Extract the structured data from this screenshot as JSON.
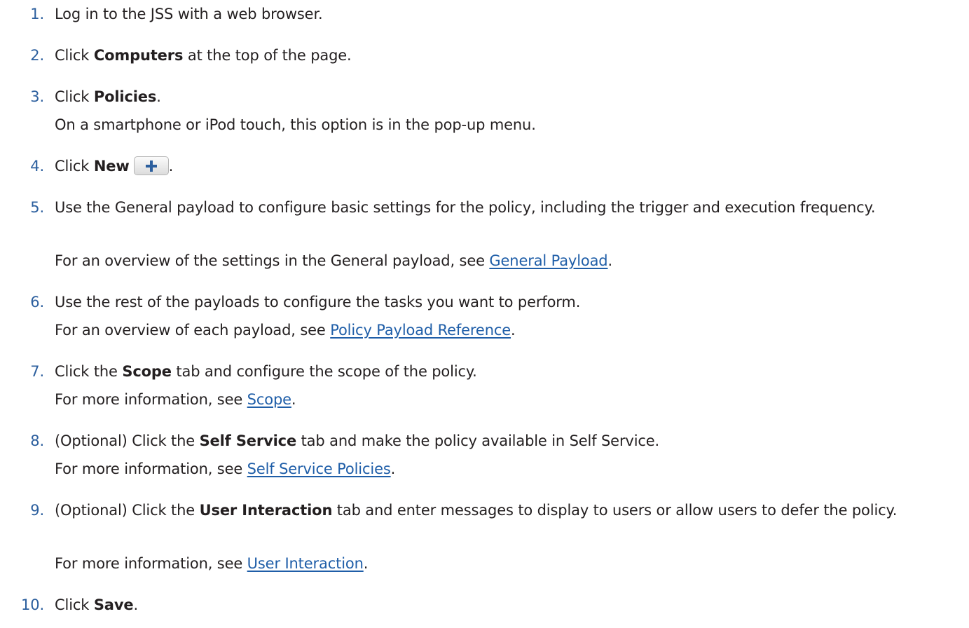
{
  "steps": [
    {
      "num": "1.",
      "parts": [
        "Log in to the JSS with a web browser."
      ]
    },
    {
      "num": "2.",
      "parts": [
        "Click ",
        "Computers",
        " at the top of the page."
      ]
    },
    {
      "num": "3.",
      "parts": [
        "Click ",
        "Policies",
        "."
      ],
      "note": "On a smartphone or iPod touch, this option is in the pop-up menu."
    },
    {
      "num": "4.",
      "parts": [
        "Click ",
        "New",
        "."
      ]
    },
    {
      "num": "5.",
      "text": "Use the General payload to configure basic settings for the policy, including the trigger and execution frequency.",
      "note_prefix": "For an overview of the settings in the General payload, see ",
      "link": "General Payload",
      "note_suffix": "."
    },
    {
      "num": "6.",
      "text": "Use the rest of the payloads to configure the tasks you want to perform.",
      "note_prefix": "For an overview of each payload, see ",
      "link": "Policy Payload Reference",
      "note_suffix": "."
    },
    {
      "num": "7.",
      "parts": [
        "Click the ",
        "Scope",
        " tab and configure the scope of the policy."
      ],
      "note_prefix": "For more information, see ",
      "link": "Scope",
      "note_suffix": "."
    },
    {
      "num": "8.",
      "parts": [
        "(Optional) Click the ",
        "Self Service",
        " tab and make the policy available in Self Service."
      ],
      "note_prefix": "For more information, see ",
      "link": "Self Service Policies",
      "note_suffix": "."
    },
    {
      "num": "9.",
      "parts": [
        "(Optional) Click the ",
        "User Interaction",
        " tab and enter messages to display to users or allow users to defer the policy."
      ],
      "note_prefix": "For more information, see ",
      "link": "User Interaction",
      "note_suffix": "."
    },
    {
      "num": "10.",
      "parts": [
        "Click ",
        "Save",
        "."
      ]
    }
  ],
  "icons": {
    "new_button": "plus-icon",
    "accent": "#2c5f9e",
    "link_color": "#1f5ea8"
  }
}
